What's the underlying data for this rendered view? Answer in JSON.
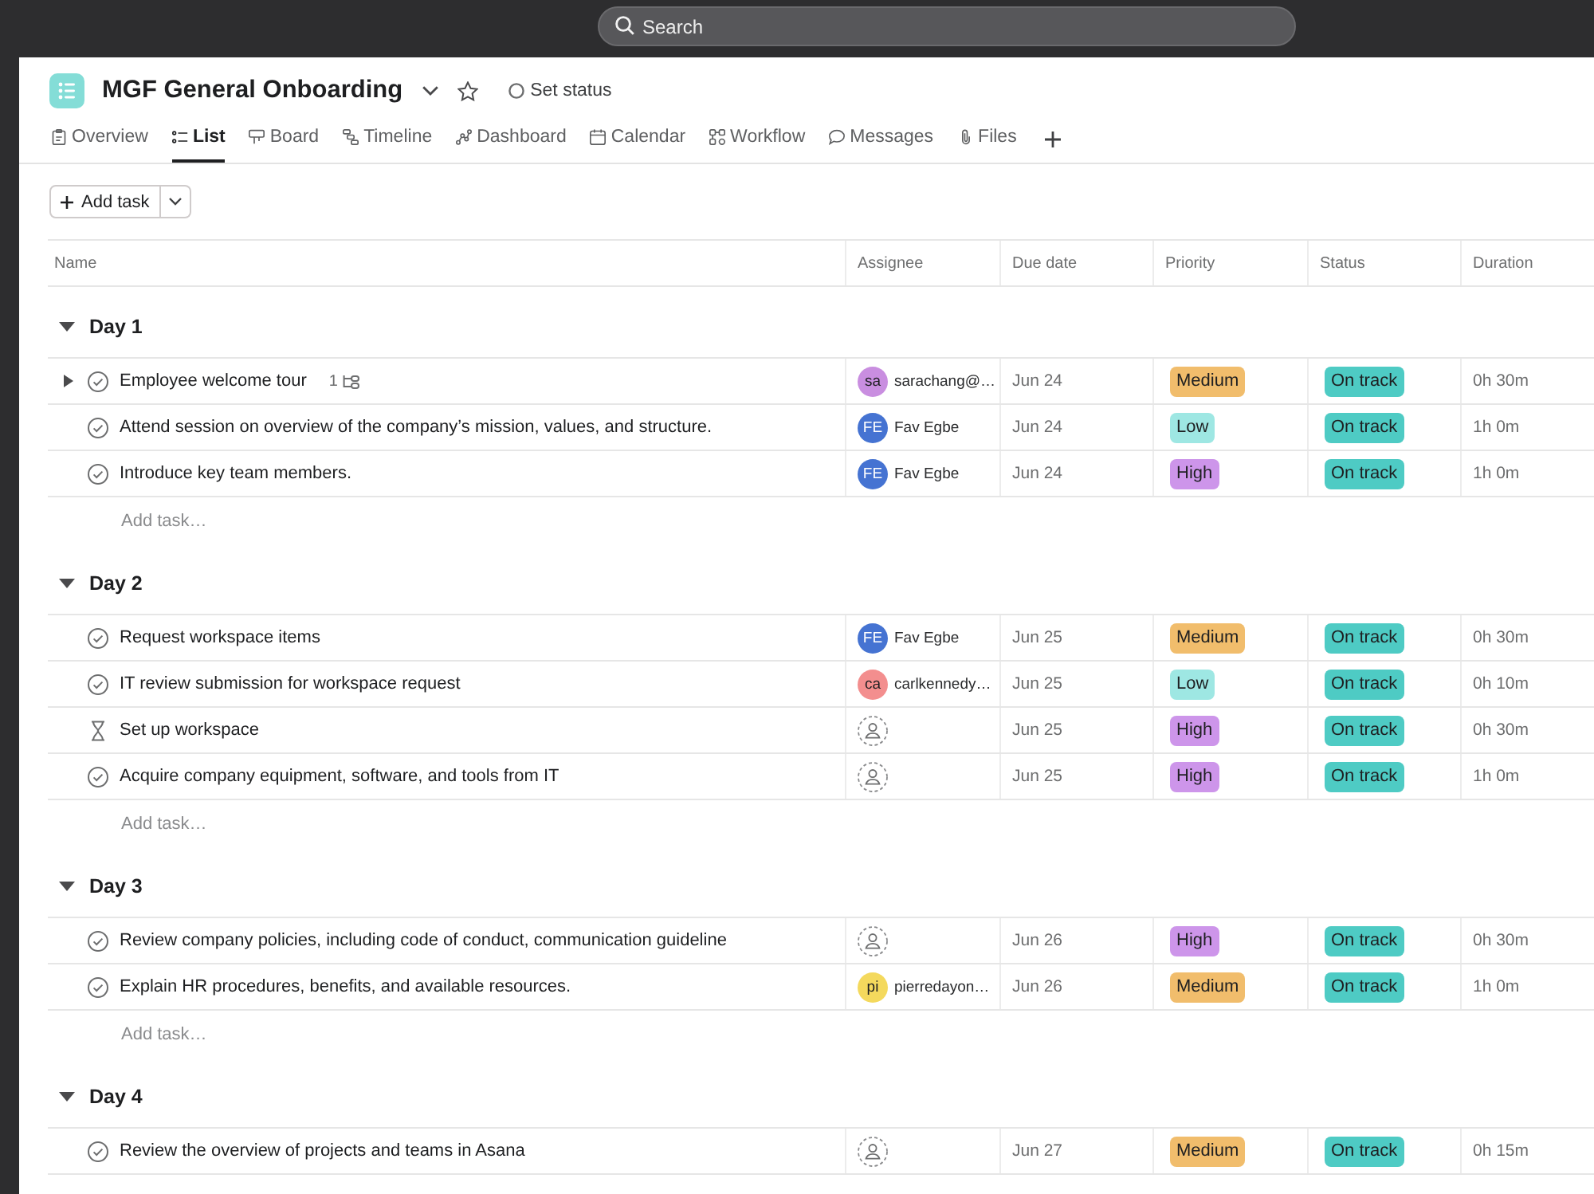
{
  "top_bar": {
    "search": {
      "placeholder": "Search"
    }
  },
  "project": {
    "title": "MGF General Onboarding",
    "starred": false,
    "status_button": "Set status"
  },
  "tabs": [
    {
      "label": "Overview",
      "selected": false
    },
    {
      "label": "List",
      "selected": true
    },
    {
      "label": "Board",
      "selected": false
    },
    {
      "label": "Timeline",
      "selected": false
    },
    {
      "label": "Dashboard",
      "selected": false
    },
    {
      "label": "Calendar",
      "selected": false
    },
    {
      "label": "Workflow",
      "selected": false
    },
    {
      "label": "Messages",
      "selected": false
    },
    {
      "label": "Files",
      "selected": false
    }
  ],
  "toolbar": {
    "add_task_button": "Add task"
  },
  "table": {
    "columns": [
      "Name",
      "Assignee",
      "Due date",
      "Priority",
      "Status",
      "Duration"
    ],
    "sections": [
      {
        "title": "Day 1",
        "expanded": true,
        "tasks": [
          {
            "kind": "task",
            "completed": false,
            "name": "Employee welcome tour",
            "subtasks": {
              "count": "1",
              "expanded": false
            },
            "assignee": {
              "initials": "sa",
              "name": "sarachang@…",
              "color": "#c98ee0"
            },
            "due": "Jun 24",
            "priority": {
              "label": "Medium",
              "color": "#f1bd6c"
            },
            "status": {
              "label": "On track",
              "color": "#4ecbc4"
            },
            "duration": "0h 30m"
          },
          {
            "kind": "task",
            "completed": false,
            "name": "Attend session on overview of the company’s mission, values, and structure.",
            "assignee": {
              "initials": "FE",
              "name": "Fav Egbe",
              "color": "#4573d2"
            },
            "due": "Jun 24",
            "priority": {
              "label": "Low",
              "color": "#9ee7e3"
            },
            "status": {
              "label": "On track",
              "color": "#4ecbc4"
            },
            "duration": "1h 0m"
          },
          {
            "kind": "task",
            "completed": false,
            "name": "Introduce key team members.",
            "assignee": {
              "initials": "FE",
              "name": "Fav Egbe",
              "color": "#4573d2"
            },
            "due": "Jun 24",
            "priority": {
              "label": "High",
              "color": "#cd95ea"
            },
            "status": {
              "label": "On track",
              "color": "#4ecbc4"
            },
            "duration": "1h 0m"
          }
        ],
        "add_task": "Add task…"
      },
      {
        "title": "Day 2",
        "expanded": true,
        "tasks": [
          {
            "kind": "task",
            "completed": false,
            "name": "Request workspace items",
            "assignee": {
              "initials": "FE",
              "name": "Fav Egbe",
              "color": "#4573d2"
            },
            "due": "Jun 25",
            "priority": {
              "label": "Medium",
              "color": "#f1bd6c"
            },
            "status": {
              "label": "On track",
              "color": "#4ecbc4"
            },
            "duration": "0h 30m"
          },
          {
            "kind": "task",
            "completed": false,
            "name": "IT review submission for workspace request",
            "assignee": {
              "initials": "ca",
              "name": "carlkennedy…",
              "color": "#f38e8e"
            },
            "due": "Jun 25",
            "priority": {
              "label": "Low",
              "color": "#9ee7e3"
            },
            "status": {
              "label": "On track",
              "color": "#4ecbc4"
            },
            "duration": "0h 10m"
          },
          {
            "kind": "waiting",
            "completed": false,
            "name": "Set up workspace",
            "due": "Jun 25",
            "priority": {
              "label": "High",
              "color": "#cd95ea"
            },
            "status": {
              "label": "On track",
              "color": "#4ecbc4"
            },
            "duration": "0h 30m"
          },
          {
            "kind": "task",
            "completed": false,
            "name": "Acquire company equipment, software, and tools from IT",
            "due": "Jun 25",
            "priority": {
              "label": "High",
              "color": "#cd95ea"
            },
            "status": {
              "label": "On track",
              "color": "#4ecbc4"
            },
            "duration": "1h 0m"
          }
        ],
        "add_task": "Add task…"
      },
      {
        "title": "Day 3",
        "expanded": true,
        "tasks": [
          {
            "kind": "task",
            "completed": false,
            "name": "Review company policies, including code of conduct, communication guideline",
            "due": "Jun 26",
            "priority": {
              "label": "High",
              "color": "#cd95ea"
            },
            "status": {
              "label": "On track",
              "color": "#4ecbc4"
            },
            "duration": "0h 30m"
          },
          {
            "kind": "task",
            "completed": false,
            "name": "Explain HR procedures, benefits, and available resources.",
            "assignee": {
              "initials": "pi",
              "name": "pierredayon…",
              "color": "#f4d95d"
            },
            "due": "Jun 26",
            "priority": {
              "label": "Medium",
              "color": "#f1bd6c"
            },
            "status": {
              "label": "On track",
              "color": "#4ecbc4"
            },
            "duration": "1h 0m"
          }
        ],
        "add_task": "Add task…"
      },
      {
        "title": "Day 4",
        "expanded": true,
        "tasks": [
          {
            "kind": "task",
            "completed": false,
            "name": "Review the overview of projects and teams in Asana",
            "due": "Jun 27",
            "priority": {
              "label": "Medium",
              "color": "#f1bd6c"
            },
            "status": {
              "label": "On track",
              "color": "#4ecbc4"
            },
            "duration": "0h 15m"
          }
        ]
      }
    ]
  }
}
